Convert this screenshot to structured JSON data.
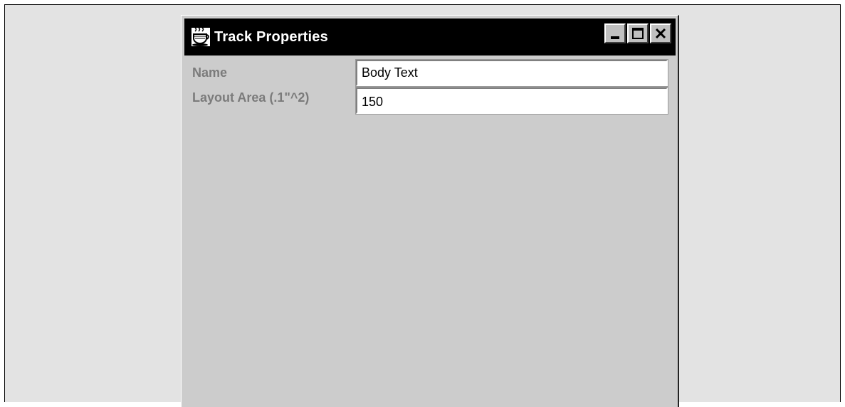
{
  "window": {
    "title": "Track Properties",
    "icon": "java-coffee-cup-icon",
    "controls": {
      "minimize": "minimize-icon",
      "maximize": "maximize-icon",
      "close": "close-icon"
    }
  },
  "form": {
    "name_label": "Name",
    "name_value": "Body Text",
    "area_label": "Layout Area (.1\"^2)",
    "area_value": "150"
  },
  "colors": {
    "titlebar": "#000000",
    "title_text": "#ffffff",
    "window_bg": "#cccccc",
    "page_bg": "#e3e3e3",
    "label_text": "#7b7b7b"
  }
}
